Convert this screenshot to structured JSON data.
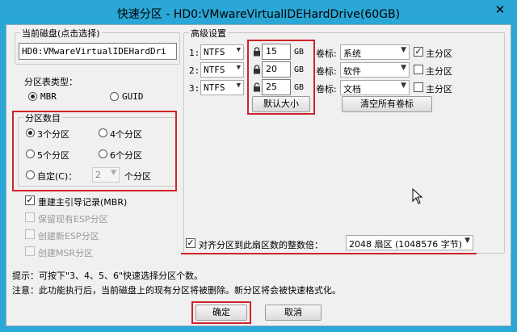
{
  "window": {
    "title": "快速分区 - HD0:VMwareVirtualIDEHardDrive(60GB)"
  },
  "current_disk": {
    "group_label": "当前磁盘(点击选择)",
    "value": "HD0:VMwareVirtualIDEHardDri"
  },
  "partition_table": {
    "label": "分区表类型：",
    "options": [
      "MBR",
      "GUID"
    ],
    "selected": "MBR"
  },
  "partition_count": {
    "group_label": "分区数目",
    "options": [
      "3个分区",
      "4个分区",
      "5个分区",
      "6个分区"
    ],
    "selected": "3个分区",
    "custom_label": "自定(C)：",
    "custom_value": "2",
    "custom_suffix": "个分区"
  },
  "options": {
    "rebuild_mbr": "重建主引导记录(MBR)",
    "keep_esp": "保留现有ESP分区",
    "create_esp": "创建新ESP分区",
    "create_msr": "创建MSR分区"
  },
  "advanced": {
    "group_label": "高级设置",
    "volume_label_text": "卷标:",
    "primary_label": "主分区",
    "unit": "GB",
    "rows": [
      {
        "index": "1:",
        "fs": "NTFS",
        "size": "15",
        "volume": "系统",
        "primary": true
      },
      {
        "index": "2:",
        "fs": "NTFS",
        "size": "20",
        "volume": "软件",
        "primary": false
      },
      {
        "index": "3:",
        "fs": "NTFS",
        "size": "25",
        "volume": "文档",
        "primary": false
      }
    ],
    "default_size_button": "默认大小",
    "clear_labels_button": "清空所有卷标"
  },
  "align": {
    "label": "对齐分区到此扇区数的整数倍：",
    "value": "2048 扇区 (1048576 字节)"
  },
  "hints": {
    "tip": "提示：可按下\"3、4、5、6\"快速选择分区个数。",
    "note": "注意：此功能执行后，当前磁盘上的现有分区将被删除。新分区将会被快速格式化。"
  },
  "buttons": {
    "ok": "确定",
    "cancel": "取消"
  },
  "colors": {
    "titlebar": "#2aa7d6",
    "highlight": "#d0232a"
  }
}
